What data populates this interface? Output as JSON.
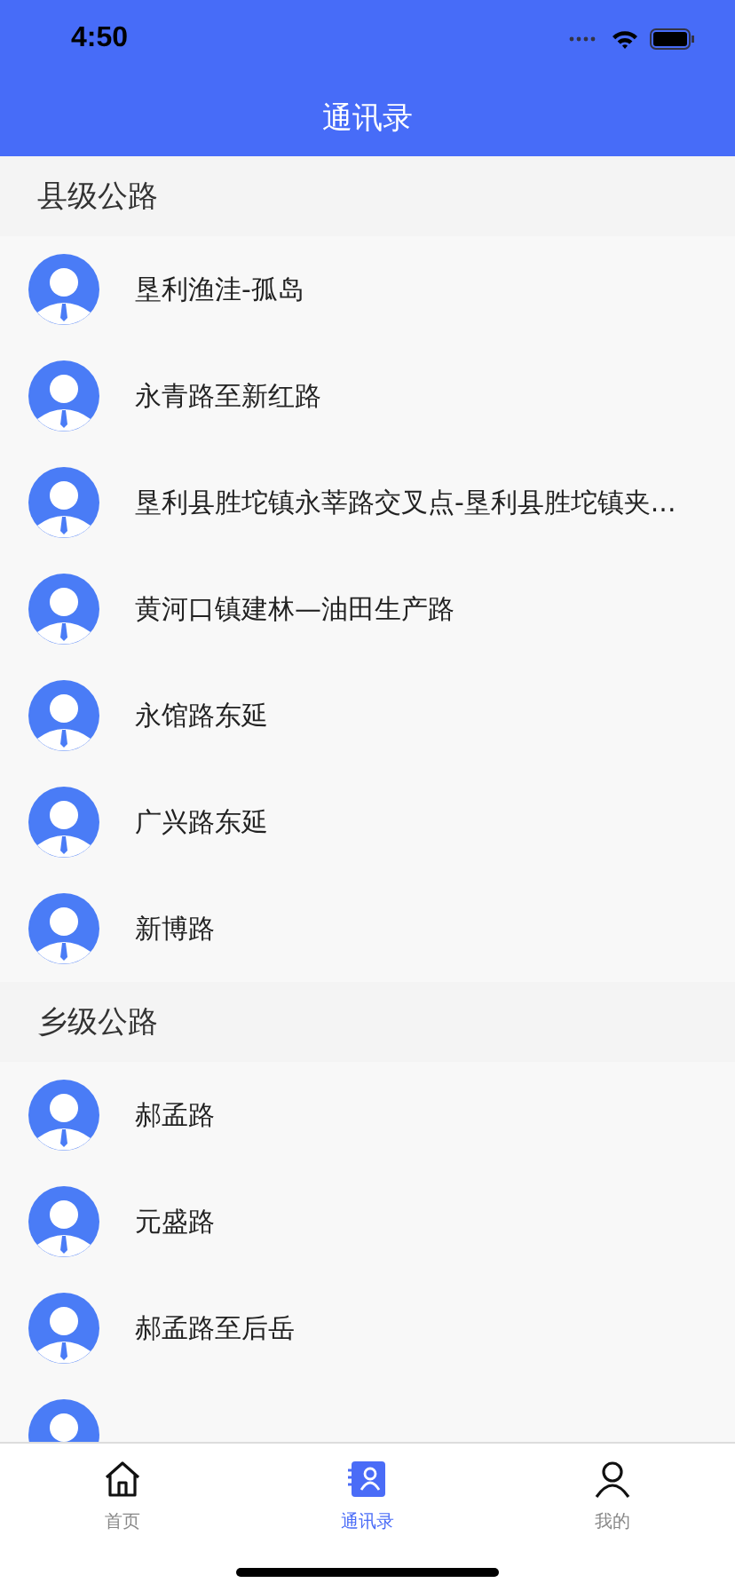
{
  "status_bar": {
    "time": "4:50"
  },
  "nav_bar": {
    "title": "通讯录"
  },
  "sections": [
    {
      "title": "县级公路",
      "rows": [
        {
          "kind": "contact",
          "name": "垦利渔洼-孤岛"
        },
        {
          "kind": "contact",
          "name": "永青路至新红路"
        },
        {
          "kind": "contact",
          "name": "垦利县胜坨镇永莘路交叉点-垦利县胜坨镇夹..."
        },
        {
          "kind": "contact",
          "name": "黄河口镇建林—油田生产路"
        },
        {
          "kind": "contact",
          "name": "永馆路东延"
        },
        {
          "kind": "contact",
          "name": "广兴路东延"
        },
        {
          "kind": "contact",
          "name": "新博路"
        }
      ]
    },
    {
      "title": "乡级公路",
      "rows": [
        {
          "kind": "contact",
          "name": "郝孟路"
        },
        {
          "kind": "contact",
          "name": "元盛路"
        },
        {
          "kind": "contact",
          "name": "郝孟路至后岳"
        },
        {
          "kind": "avatar-only"
        }
      ]
    }
  ],
  "tab_bar": [
    {
      "kind": "home",
      "label": "首页",
      "selected": false
    },
    {
      "kind": "contacts",
      "label": "通讯录",
      "selected": true
    },
    {
      "kind": "profile",
      "label": "我的",
      "selected": false
    }
  ]
}
